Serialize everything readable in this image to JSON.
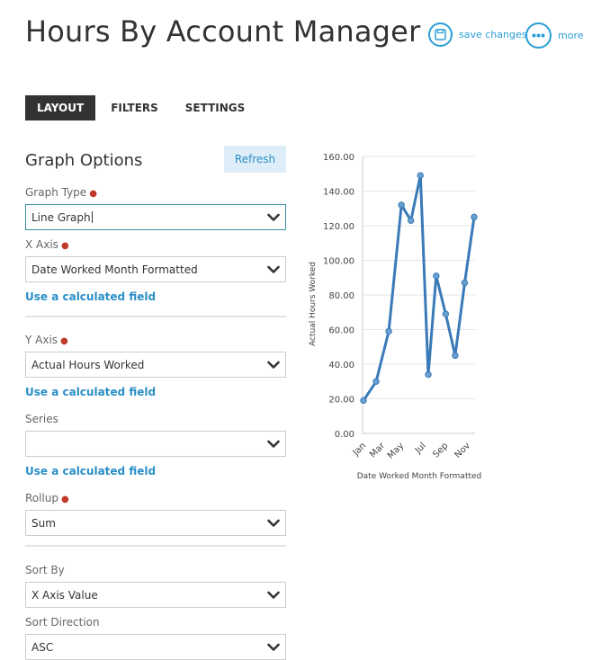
{
  "header": {
    "title": "Hours By Account Manager",
    "save_label": "save changes",
    "more_label": "more"
  },
  "tabs": [
    {
      "label": "LAYOUT",
      "active": true
    },
    {
      "label": "FILTERS",
      "active": false
    },
    {
      "label": "SETTINGS",
      "active": false
    }
  ],
  "options": {
    "title": "Graph Options",
    "refresh_label": "Refresh",
    "graph_type": {
      "label": "Graph Type",
      "required": true,
      "value": "Line Graph"
    },
    "x_axis": {
      "label": "X Axis",
      "required": true,
      "value": "Date Worked Month Formatted",
      "calc_link": "Use a calculated field"
    },
    "y_axis": {
      "label": "Y Axis",
      "required": true,
      "value": "Actual Hours Worked",
      "calc_link": "Use a calculated field"
    },
    "series": {
      "label": "Series",
      "required": false,
      "value": "",
      "calc_link": "Use a calculated field"
    },
    "rollup": {
      "label": "Rollup",
      "required": true,
      "value": "Sum"
    },
    "sort_by": {
      "label": "Sort By",
      "required": false,
      "value": "X Axis Value"
    },
    "sort_direction": {
      "label": "Sort Direction",
      "required": false,
      "value": "ASC"
    }
  },
  "colors": {
    "accent": "#2a9fd6",
    "line": "#3a7ab8",
    "required": "#c0392b"
  },
  "chart_data": {
    "type": "line",
    "xlabel": "Date Worked Month Formatted",
    "ylabel": "Actual Hours Worked",
    "ylim": [
      0,
      160
    ],
    "yticks": [
      "0.00",
      "20.00",
      "40.00",
      "60.00",
      "80.00",
      "100.00",
      "120.00",
      "140.00",
      "160.00"
    ],
    "x_tick_labels": [
      "Jan",
      "Mar",
      "May",
      "Jul",
      "Sep",
      "Nov"
    ],
    "grid": true,
    "series": [
      {
        "x": [
          1,
          1.8,
          2.6,
          3.4,
          4,
          4.6,
          5.1,
          5.6,
          6.2,
          6.8,
          7.4,
          8
        ],
        "values": [
          19,
          30,
          59,
          132,
          123,
          149,
          34,
          91,
          69,
          45,
          87,
          125
        ]
      }
    ]
  }
}
